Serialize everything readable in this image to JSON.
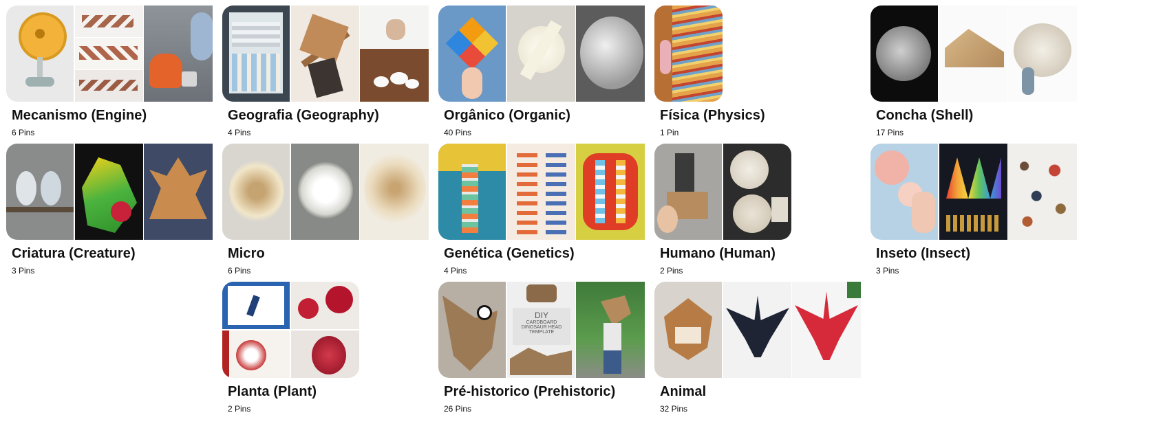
{
  "boards": [
    {
      "title": "Mecanismo (Engine)",
      "pins": "6 Pins"
    },
    {
      "title": "Geografia (Geography)",
      "pins": "4 Pins"
    },
    {
      "title": "Orgânico (Organic)",
      "pins": "40 Pins"
    },
    {
      "title": "Física (Physics)",
      "pins": "1 Pin"
    },
    {
      "title": "Concha (Shell)",
      "pins": "17 Pins"
    },
    {
      "title": "Criatura (Creature)",
      "pins": "3 Pins"
    },
    {
      "title": "Micro",
      "pins": "6 Pins"
    },
    {
      "title": "Genética (Genetics)",
      "pins": "4 Pins"
    },
    {
      "title": "Humano (Human)",
      "pins": "2 Pins"
    },
    {
      "title": "Inseto (Insect)",
      "pins": "3 Pins"
    },
    {
      "title": "Planta (Plant)",
      "pins": "2 Pins"
    },
    {
      "title": "Pré-historico (Prehistoric)",
      "pins": "26 Pins"
    },
    {
      "title": "Animal",
      "pins": "32 Pins"
    }
  ],
  "image_texts": {
    "dino_diy": "DIY",
    "dino_line1": "CARDBOARD",
    "dino_line2": "DINOSAUR HEAD",
    "dino_line3": "TEMPLATE"
  }
}
